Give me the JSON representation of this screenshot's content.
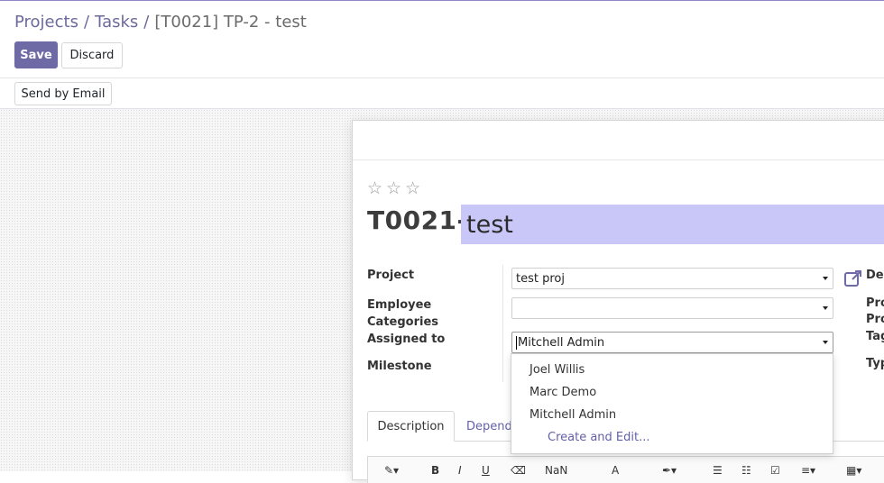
{
  "breadcrumb": {
    "items": [
      "Projects",
      "Tasks"
    ],
    "separator": "/",
    "current": "[T0021] TP-2 - test"
  },
  "buttons": {
    "save": "Save",
    "discard": "Discard",
    "send_email": "Send by Email"
  },
  "task": {
    "stars": [
      "☆",
      "☆",
      "☆"
    ],
    "reference": "T0021-",
    "title": "test"
  },
  "form": {
    "project_label": "Project",
    "project_value": "test proj",
    "employee_categories_label": "Employee Categories",
    "employee_categories_value": "",
    "assigned_label": "Assigned to",
    "assigned_value": "Mitchell Admin",
    "milestone_label": "Milestone",
    "right_labels": [
      "Dea",
      "Pro",
      "Pro",
      "Tag",
      "Typ"
    ]
  },
  "dropdown": {
    "options": [
      "Joel Willis",
      "Marc Demo",
      "Mitchell Admin"
    ],
    "create": "Create and Edit..."
  },
  "tabs": {
    "description": "Description",
    "dependencies": "Depend"
  },
  "toolbar": {
    "bold": "B",
    "italic": "I",
    "underline": "U",
    "font_size": "NaN",
    "font_color": "A"
  },
  "colors": {
    "primary": "#6e6aa6",
    "title_highlight": "#c9c7f7",
    "link": "#6361a8"
  }
}
